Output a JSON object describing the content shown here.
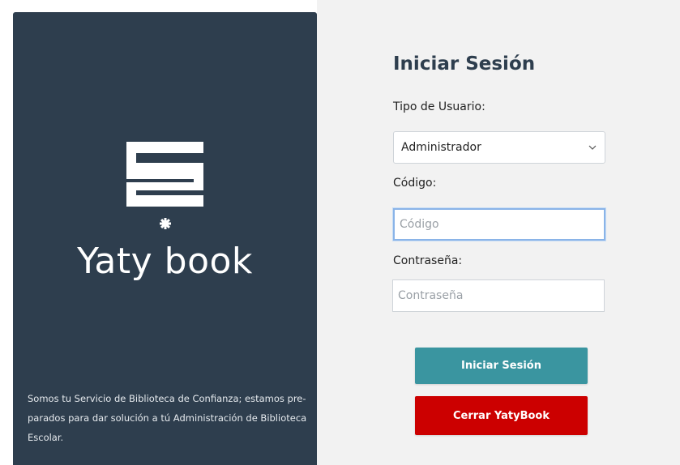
{
  "brand": {
    "name": "Yaty book",
    "tagline": "Somos tu Servicio de Biblioteca de Confianza; estamos pre-parados para dar solución a tú Administración de Biblioteca Escolar."
  },
  "form": {
    "title": "Iniciar Sesión",
    "user_type_label": "Tipo de Usuario:",
    "user_type_value": "Administrador",
    "code_label": "Código:",
    "code_placeholder": "Código",
    "password_label": "Contraseña:",
    "password_placeholder": "Contraseña",
    "login_button": "Iniciar Sesión",
    "close_button": "Cerrar YatyBook"
  },
  "icons": {
    "logo": "book-stack-logo-icon",
    "dropdown": "chevron-down-icon"
  },
  "colors": {
    "panel_dark": "#2e3e4e",
    "login_button": "#3a95a0",
    "close_button": "#cc0000",
    "right_background": "#f2f2f2"
  }
}
